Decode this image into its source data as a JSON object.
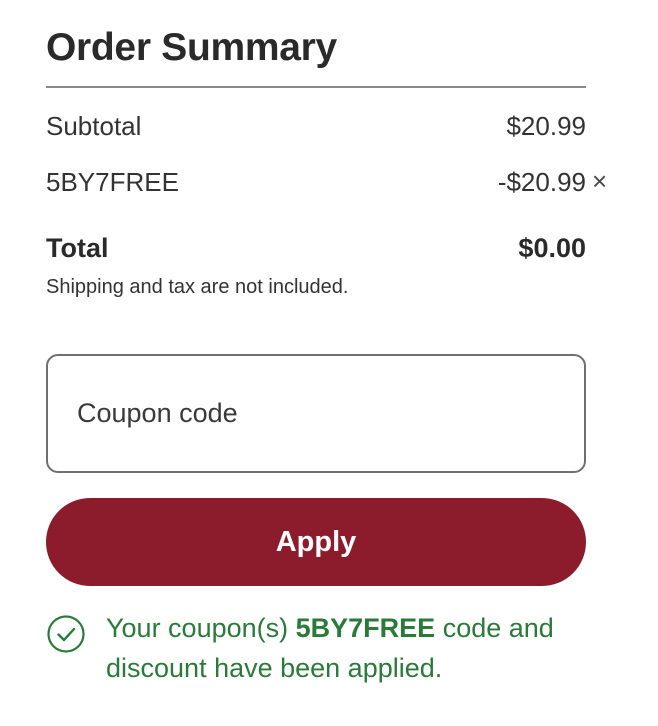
{
  "summary": {
    "title": "Order Summary",
    "subtotal_label": "Subtotal",
    "subtotal_value": "$20.99",
    "coupon_code": "5BY7FREE",
    "coupon_discount": "-$20.99",
    "remove_symbol": "×",
    "total_label": "Total",
    "total_value": "$0.00",
    "note": "Shipping and tax are not included."
  },
  "coupon_form": {
    "placeholder": "Coupon code",
    "value": "",
    "apply_label": "Apply"
  },
  "message": {
    "prefix": "Your coupon(s) ",
    "code": "5BY7FREE",
    "suffix": " code and discount have been applied.",
    "icon": "check-circle-icon"
  },
  "colors": {
    "primary_button": "#8c1b2b",
    "success": "#2a7a3a",
    "text": "#2b2b2b",
    "divider": "#8a8a8a"
  }
}
